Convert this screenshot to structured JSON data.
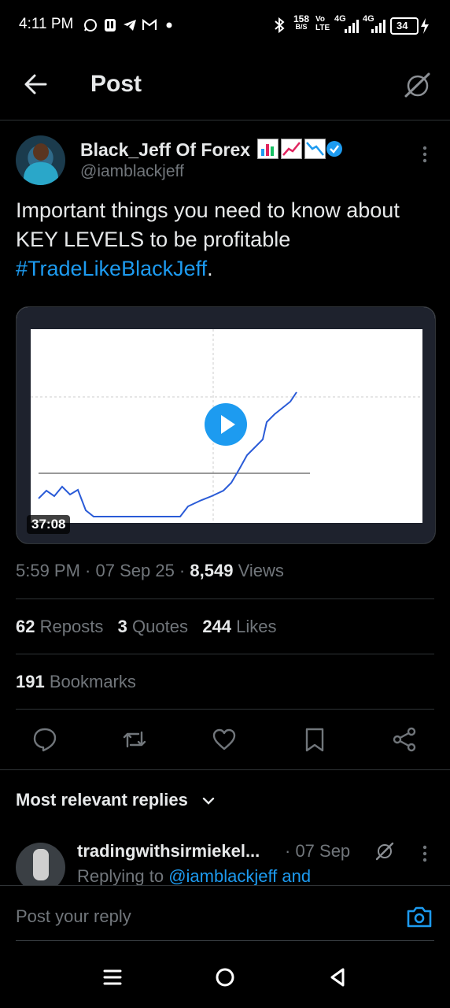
{
  "status_bar": {
    "time": "4:11 PM",
    "speed_value": "158",
    "speed_unit": "B/S",
    "volte": "Vo\nLTE",
    "net1": "4G",
    "net2": "4G",
    "battery": "34",
    "icons": [
      "whatsapp-icon",
      "app-icon",
      "telegram-icon",
      "gmail-icon",
      "dot-icon",
      "bluetooth-icon",
      "signal-icon",
      "battery-icon",
      "charging-icon"
    ]
  },
  "header": {
    "title": "Post"
  },
  "post": {
    "author_name": "Black_Jeff Of Forex",
    "author_handle": "@iamblackjeff",
    "text_main": "Important things you need to know about KEY LEVELS to be profitable ",
    "hashtag": "#TradeLikeBlackJeff",
    "text_end": ".",
    "video_duration": "37:08",
    "time": "5:59 PM",
    "date": "07 Sep 25",
    "views_count": "8,549",
    "views_label": "Views",
    "reposts_count": "62",
    "reposts_label": "Reposts",
    "quotes_count": "3",
    "quotes_label": "Quotes",
    "likes_count": "244",
    "likes_label": "Likes",
    "bookmarks_count": "191",
    "bookmarks_label": "Bookmarks"
  },
  "replies": {
    "header": "Most relevant replies",
    "first": {
      "name": "tradingwithsirmiekel...",
      "date": "· 07 Sep",
      "replying_prefix": "Replying to ",
      "replying_to": "@iamblackjeff and"
    }
  },
  "compose": {
    "placeholder": "Post your reply"
  },
  "colors": {
    "accent": "#1d9bf0",
    "muted": "#71767b",
    "text": "#e7e9ea",
    "divider": "#2f3336"
  }
}
